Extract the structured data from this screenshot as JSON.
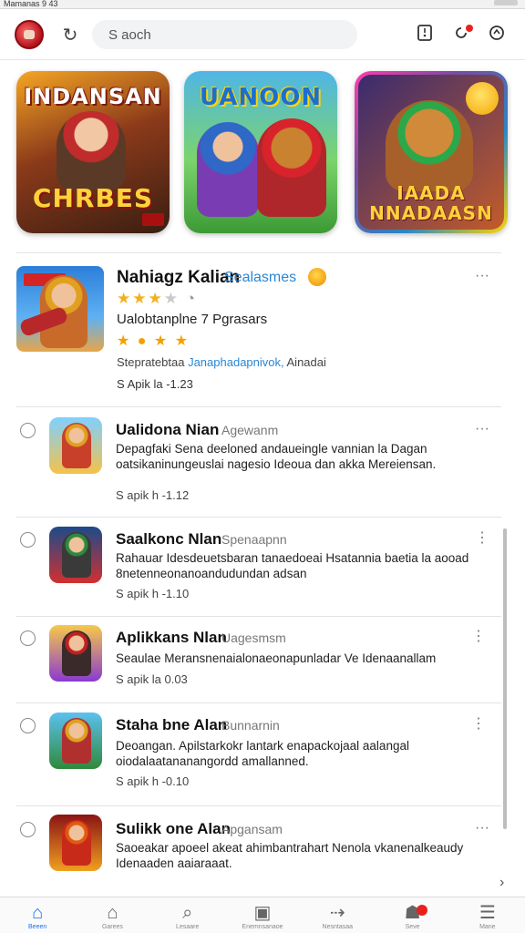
{
  "status_bar": {
    "time_text": "Mamanas 9 43"
  },
  "header": {
    "search_placeholder": "S aoch",
    "icons": [
      "refresh-icon",
      "download-icon",
      "notification-icon",
      "settings-icon"
    ]
  },
  "banners": [
    {
      "title_top": "INDANSAN",
      "title_bottom": "CHRBES"
    },
    {
      "title_top": "UANOON",
      "title_bottom": ""
    },
    {
      "title_top": "IAADA",
      "title_bottom": "NNADAASN"
    }
  ],
  "featured": {
    "title": "Nahiagz Kalian",
    "subtitle": "Sealasmes",
    "rating": 3,
    "rating_max": 5,
    "stars_text": "★★★",
    "stars_off_text": "★",
    "rating_badge": "◔",
    "description": "Ualobtanplne 7 Pgrasars",
    "chips_text": "★ ● ★ ★",
    "link_prefix": "Stepratebtaa",
    "link_text": "Janaphadapnivok,",
    "link_suffix": "Ainadai",
    "meta": "S Apik la -1.23"
  },
  "apps": [
    {
      "title": "Ualidona Nian",
      "category": "Agewanm",
      "description": "Depagfaki Sena deeloned andaueingle vannian la Dagan oatsikaninungeuslai nagesio Ideoua dan akka Mereiensan.",
      "meta": "S apik h -1.12"
    },
    {
      "title": "Saalkonc Nlan",
      "category": "Spenaapnn",
      "description": "Rahauar Idesdeuetsbaran tanaedoeai Hsatannia baetia la aooad 8netenneonanoandudundan adsan",
      "meta": "S apik h -1.10"
    },
    {
      "title": "Aplikkans Nlan",
      "category": "Uagesmsm",
      "description": "Seaulae Meransnenaialonaeonapunladar Ve Idenaanallam",
      "meta": "S apik la 0.03"
    },
    {
      "title": "Staha bne Alan",
      "category": "Bunnarnin",
      "description": "Deoangan. Apilstarkokr lantark enapackojaal aalangal oiodalaatananangordd amallanned.",
      "meta": "S apik h -0.10"
    },
    {
      "title": "Sulikk one Alan",
      "category": "Apgansam",
      "description": "Saoeakar apoeel akeat ahimbantrahart Nenola vkanenalkeaudy Idenaaden aaiaraaat.",
      "meta": ""
    }
  ],
  "bottom_nav": [
    {
      "label": "Beeen",
      "icon": "home-icon",
      "active": true
    },
    {
      "label": "Garees",
      "icon": "games-icon",
      "active": false
    },
    {
      "label": "Lesaare",
      "icon": "search-icon",
      "active": false
    },
    {
      "label": "Enemnsanaoe",
      "icon": "apps-icon",
      "active": false
    },
    {
      "label": "Nesntasaa",
      "icon": "share-icon",
      "active": false
    },
    {
      "label": "Seve",
      "icon": "account-icon",
      "active": false
    },
    {
      "label": "Mane",
      "icon": "menu-icon",
      "active": false
    }
  ],
  "colors": {
    "accent": "#1a73e8",
    "link": "#2a86d6",
    "badge": "#e8221b"
  }
}
